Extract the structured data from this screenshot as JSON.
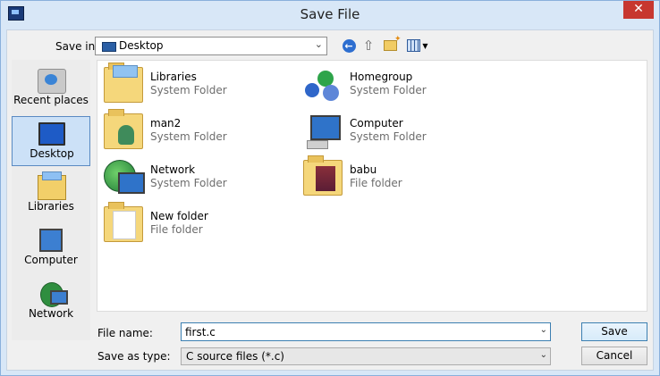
{
  "window": {
    "title": "Save File",
    "close_glyph": "✕"
  },
  "toolbar": {
    "save_in_label": "Save in:",
    "location": "Desktop",
    "back_glyph": "←",
    "up_glyph": "⇧",
    "icons": [
      "back-arrow-icon",
      "up-folder-icon",
      "new-folder-icon",
      "view-menu-icon"
    ]
  },
  "places": [
    {
      "label": "Recent places",
      "icon": "recent-places-icon"
    },
    {
      "label": "Desktop",
      "icon": "desktop-icon",
      "selected": true
    },
    {
      "label": "Libraries",
      "icon": "libraries-icon"
    },
    {
      "label": "Computer",
      "icon": "computer-icon"
    },
    {
      "label": "Network",
      "icon": "network-icon"
    }
  ],
  "files": [
    {
      "name": "Libraries",
      "type": "System Folder",
      "icon": "libraries-folder-icon"
    },
    {
      "name": "Homegroup",
      "type": "System Folder",
      "icon": "homegroup-icon"
    },
    {
      "name": "man2",
      "type": "System Folder",
      "icon": "user-folder-icon"
    },
    {
      "name": "Computer",
      "type": "System Folder",
      "icon": "computer-icon"
    },
    {
      "name": "Network",
      "type": "System Folder",
      "icon": "network-icon"
    },
    {
      "name": "babu",
      "type": "File folder",
      "icon": "folder-icon"
    },
    {
      "name": "New folder",
      "type": "File folder",
      "icon": "folder-icon"
    }
  ],
  "form": {
    "file_name_label": "File name:",
    "file_name_value": "first.c",
    "save_as_type_label": "Save as type:",
    "save_as_type_value": "C source files (*.c)",
    "save_button": "Save",
    "cancel_button": "Cancel",
    "dropdown_glyph": "⌄"
  },
  "colors": {
    "title_bar": "#d8e7f7",
    "close_button": "#c7372f",
    "selected_place": "#cce1f7"
  }
}
